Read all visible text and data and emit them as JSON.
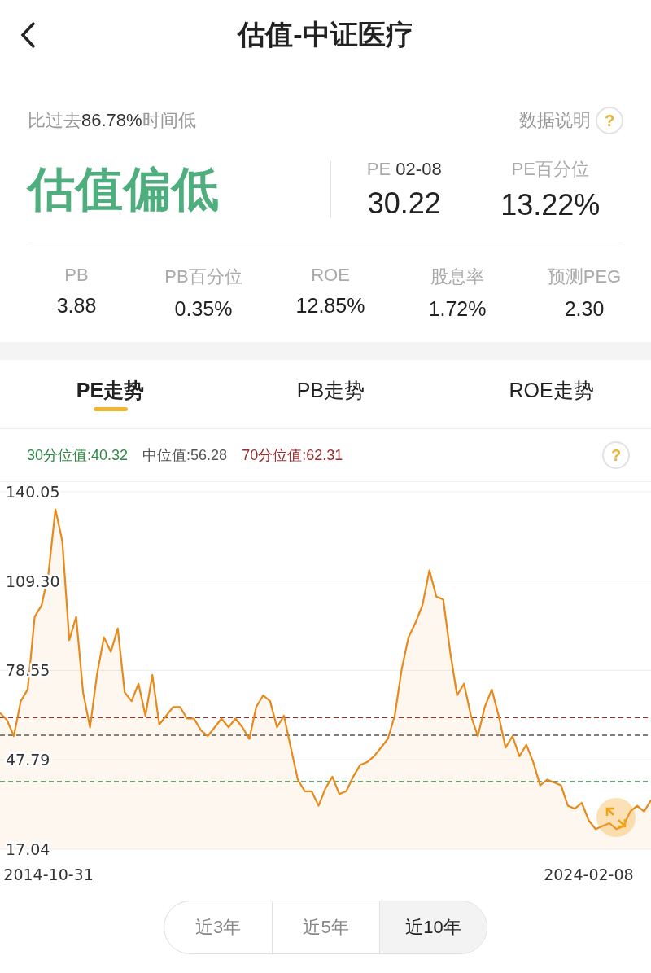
{
  "header": {
    "title": "估值-中证医疗"
  },
  "summary": {
    "note": {
      "prefix": "比过去",
      "value": "86.78%",
      "suffix": "时间低"
    },
    "help_label": "数据说明",
    "help_mark": "?",
    "verdict": "估值偏低",
    "stats": [
      {
        "label": "PE",
        "date": "02-08",
        "value": "30.22"
      },
      {
        "label": "PE百分位",
        "value": "13.22%"
      }
    ],
    "metrics": [
      {
        "label": "PB",
        "value": "3.88"
      },
      {
        "label": "PB百分位",
        "value": "0.35%"
      },
      {
        "label": "ROE",
        "value": "12.85%"
      },
      {
        "label": "股息率",
        "value": "1.72%"
      },
      {
        "label": "预测PEG",
        "value": "2.30"
      }
    ]
  },
  "tabs": [
    {
      "label": "PE走势",
      "selected": true
    },
    {
      "label": "PB走势",
      "selected": false
    },
    {
      "label": "ROE走势",
      "selected": false
    }
  ],
  "chart": {
    "help_mark": "?",
    "chart_data": {
      "type": "area",
      "ylim": [
        17.04,
        140.05
      ],
      "yticks": [
        {
          "value": 140.05,
          "label": "140.05"
        },
        {
          "value": 109.3,
          "label": "109.30"
        },
        {
          "value": 78.55,
          "label": "78.55"
        },
        {
          "value": 47.79,
          "label": "47.79"
        },
        {
          "value": 17.04,
          "label": "17.04"
        }
      ],
      "categories": [
        null,
        null,
        null,
        null,
        null,
        null,
        null,
        "2014-10-31",
        null,
        null,
        null,
        null,
        null,
        null,
        null,
        null,
        null,
        null,
        null,
        null,
        null,
        null,
        null,
        null,
        null,
        null,
        null,
        null,
        null,
        null,
        null,
        null,
        null,
        null,
        null,
        null,
        null,
        null,
        null,
        null,
        null,
        null,
        null,
        null,
        null,
        null,
        null,
        null,
        null,
        null,
        null,
        null,
        null,
        null,
        null,
        null,
        null,
        null,
        null,
        null,
        null,
        null,
        null,
        null,
        null,
        null,
        null,
        null,
        null,
        null,
        null,
        null,
        null,
        null,
        null,
        null,
        null,
        null,
        null,
        null,
        null,
        null,
        null,
        null,
        null,
        "2024-02-08",
        null,
        null,
        null,
        null,
        null,
        null,
        null,
        null,
        null
      ],
      "grid": true,
      "series": [
        {
          "color": "#e8891c",
          "values": [
            64,
            61.5,
            56,
            68,
            72,
            97,
            101,
            112,
            134,
            123,
            89,
            97,
            71,
            59,
            77,
            90,
            85,
            93,
            71,
            68,
            74,
            63,
            77,
            60,
            63,
            66,
            66,
            62,
            62,
            58,
            56,
            59,
            62,
            59,
            62,
            59,
            55,
            66,
            70,
            68,
            59,
            63,
            52,
            41,
            37,
            37,
            32,
            38,
            42,
            36,
            37,
            42,
            46,
            47,
            49,
            52,
            55,
            63,
            79,
            90,
            95,
            101,
            113,
            104,
            103,
            85,
            70,
            74,
            63,
            56,
            66,
            72,
            63,
            52,
            56,
            49,
            53,
            47,
            39,
            41,
            40,
            39,
            32,
            31,
            33,
            27,
            24,
            25,
            26,
            24,
            25,
            30,
            32,
            30,
            34
          ]
        },
        {
          "name": "30分位值:40.32",
          "type": "line",
          "line_style": "dashed",
          "color": "#2e8b45",
          "values": [
            40.32,
            40.32,
            40.32,
            40.32,
            40.32,
            40.32,
            40.32,
            40.32,
            40.32,
            40.32,
            40.32,
            40.32,
            40.32,
            40.32,
            40.32,
            40.32,
            40.32,
            40.32,
            40.32,
            40.32,
            40.32,
            40.32,
            40.32,
            40.32,
            40.32,
            40.32,
            40.32,
            40.32,
            40.32,
            40.32,
            40.32,
            40.32,
            40.32,
            40.32,
            40.32,
            40.32,
            40.32,
            40.32,
            40.32,
            40.32,
            40.32,
            40.32,
            40.32,
            40.32,
            40.32,
            40.32,
            40.32,
            40.32,
            40.32,
            40.32,
            40.32,
            40.32,
            40.32,
            40.32,
            40.32,
            40.32,
            40.32,
            40.32,
            40.32,
            40.32,
            40.32,
            40.32,
            40.32,
            40.32,
            40.32,
            40.32,
            40.32,
            40.32,
            40.32,
            40.32,
            40.32,
            40.32,
            40.32,
            40.32,
            40.32,
            40.32,
            40.32,
            40.32,
            40.32,
            40.32,
            40.32,
            40.32,
            40.32,
            40.32,
            40.32,
            40.32,
            40.32,
            40.32,
            40.32,
            40.32,
            40.32,
            40.32,
            40.32,
            40.32,
            40.32
          ]
        },
        {
          "name": "中位值:56.28",
          "type": "line",
          "line_style": "dashed",
          "color": "#555555",
          "values": [
            56.28,
            56.28,
            56.28,
            56.28,
            56.28,
            56.28,
            56.28,
            56.28,
            56.28,
            56.28,
            56.28,
            56.28,
            56.28,
            56.28,
            56.28,
            56.28,
            56.28,
            56.28,
            56.28,
            56.28,
            56.28,
            56.28,
            56.28,
            56.28,
            56.28,
            56.28,
            56.28,
            56.28,
            56.28,
            56.28,
            56.28,
            56.28,
            56.28,
            56.28,
            56.28,
            56.28,
            56.28,
            56.28,
            56.28,
            56.28,
            56.28,
            56.28,
            56.28,
            56.28,
            56.28,
            56.28,
            56.28,
            56.28,
            56.28,
            56.28,
            56.28,
            56.28,
            56.28,
            56.28,
            56.28,
            56.28,
            56.28,
            56.28,
            56.28,
            56.28,
            56.28,
            56.28,
            56.28,
            56.28,
            56.28,
            56.28,
            56.28,
            56.28,
            56.28,
            56.28,
            56.28,
            56.28,
            56.28,
            56.28,
            56.28,
            56.28,
            56.28,
            56.28,
            56.28,
            56.28,
            56.28,
            56.28,
            56.28,
            56.28,
            56.28,
            56.28,
            56.28,
            56.28,
            56.28,
            56.28,
            56.28,
            56.28,
            56.28,
            56.28,
            56.28
          ]
        },
        {
          "name": "70分位值:62.31",
          "type": "line",
          "line_style": "dashed",
          "color": "#9a2b2b",
          "values": [
            62.31,
            62.31,
            62.31,
            62.31,
            62.31,
            62.31,
            62.31,
            62.31,
            62.31,
            62.31,
            62.31,
            62.31,
            62.31,
            62.31,
            62.31,
            62.31,
            62.31,
            62.31,
            62.31,
            62.31,
            62.31,
            62.31,
            62.31,
            62.31,
            62.31,
            62.31,
            62.31,
            62.31,
            62.31,
            62.31,
            62.31,
            62.31,
            62.31,
            62.31,
            62.31,
            62.31,
            62.31,
            62.31,
            62.31,
            62.31,
            62.31,
            62.31,
            62.31,
            62.31,
            62.31,
            62.31,
            62.31,
            62.31,
            62.31,
            62.31,
            62.31,
            62.31,
            62.31,
            62.31,
            62.31,
            62.31,
            62.31,
            62.31,
            62.31,
            62.31,
            62.31,
            62.31,
            62.31,
            62.31,
            62.31,
            62.31,
            62.31,
            62.31,
            62.31,
            62.31,
            62.31,
            62.31,
            62.31,
            62.31,
            62.31,
            62.31,
            62.31,
            62.31,
            62.31,
            62.31,
            62.31,
            62.31,
            62.31,
            62.31,
            62.31,
            62.31,
            62.31,
            62.31,
            62.31,
            62.31,
            62.31,
            62.31,
            62.31,
            62.31,
            62.31
          ]
        }
      ]
    }
  },
  "ranges": [
    {
      "label": "近3年",
      "selected": false
    },
    {
      "label": "近5年",
      "selected": false
    },
    {
      "label": "近10年",
      "selected": true
    }
  ]
}
